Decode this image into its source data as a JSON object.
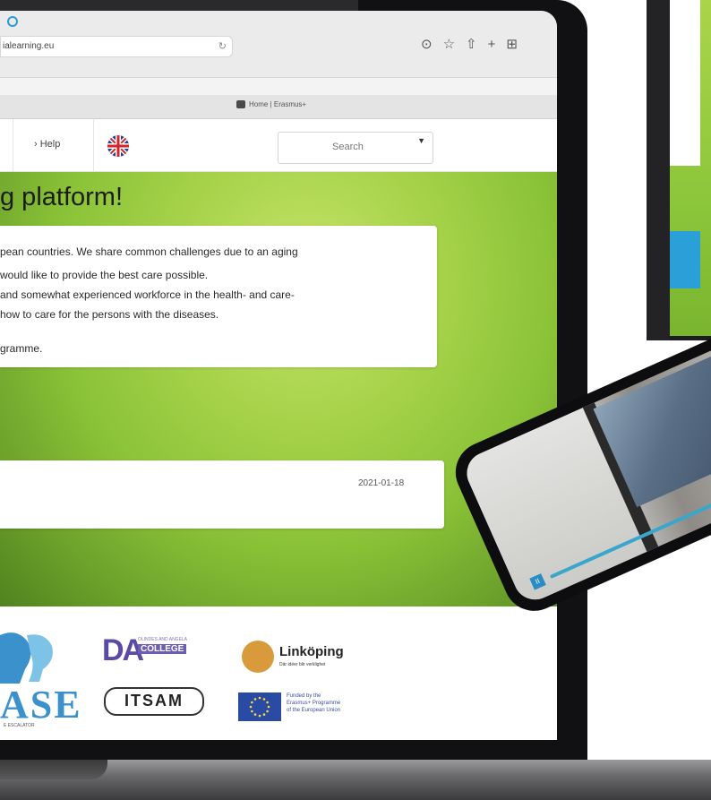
{
  "browser": {
    "url": "ialearning.eu",
    "tab_title": "Home | Erasmus+",
    "toolbar_icons": [
      "download-icon",
      "star-icon",
      "share-icon",
      "plus-icon",
      "grid-icon"
    ]
  },
  "nav": {
    "help": "› Help",
    "search_label": "Search",
    "language_flag": "uk-flag-icon"
  },
  "hero": {
    "title": "g platform!",
    "intro_lines": [
      "pean countries. We share common challenges due to an aging",
      "would like to provide the best care possible.",
      "and somewhat experienced workforce in the health- and care-",
      "how to care for the persons with the diseases.",
      "gramme."
    ]
  },
  "news": {
    "date": "2021-01-18"
  },
  "footer": {
    "base_logo": "ASE",
    "base_sub": "E ESCALATOR",
    "da_letters": "DA",
    "da_small": "OLINDES AND ANGELA",
    "da_college": "COLLEGE",
    "itsam": "ITSAM",
    "linkoping": "Linköping",
    "linkoping_sub": "Där idéer blir verklighet",
    "eu_lines": [
      "Funded by the",
      "Erasmus+ Programme",
      "of the European Union"
    ]
  },
  "colors": {
    "accent_blue": "#2d9bd5",
    "hero_green": "#a7d34a",
    "base_blue": "#3a91cc",
    "da_purple": "#5a4aa5"
  }
}
